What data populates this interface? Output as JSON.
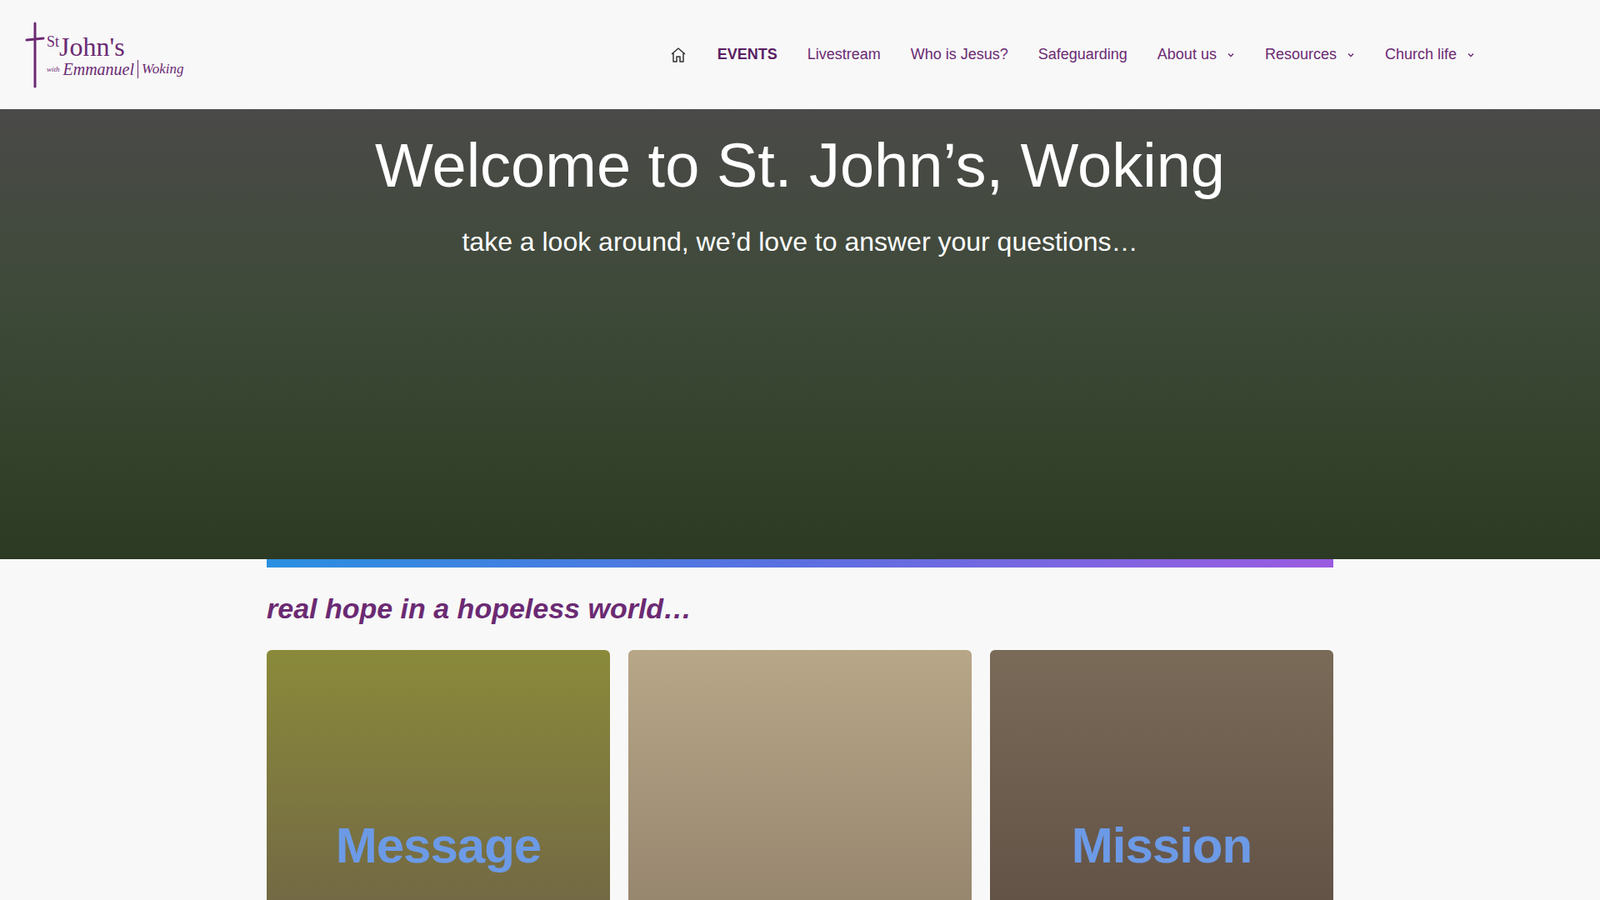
{
  "logo": {
    "st": "St",
    "johns": "John's",
    "with": "with",
    "emmanuel": "Emmanuel",
    "place": "Woking"
  },
  "nav": [
    {
      "label": "",
      "kind": "home",
      "selected": false,
      "has_dropdown": false
    },
    {
      "label": "EVENTS",
      "kind": "link",
      "selected": true,
      "has_dropdown": false
    },
    {
      "label": "Livestream",
      "kind": "link",
      "selected": false,
      "has_dropdown": false
    },
    {
      "label": "Who is Jesus?",
      "kind": "link",
      "selected": false,
      "has_dropdown": false
    },
    {
      "label": "Safeguarding",
      "kind": "link",
      "selected": false,
      "has_dropdown": false
    },
    {
      "label": "About us",
      "kind": "link",
      "selected": false,
      "has_dropdown": true
    },
    {
      "label": "Resources",
      "kind": "link",
      "selected": false,
      "has_dropdown": true
    },
    {
      "label": "Church life",
      "kind": "link",
      "selected": false,
      "has_dropdown": true
    }
  ],
  "hero": {
    "title": "Welcome to St. John’s, Woking",
    "subtitle": "take a look around, we’d love to answer your questions…"
  },
  "tagline": "real hope in a hopeless world…",
  "cards": [
    {
      "label": "Message"
    },
    {
      "label": ""
    },
    {
      "label": "Mission"
    }
  ]
}
